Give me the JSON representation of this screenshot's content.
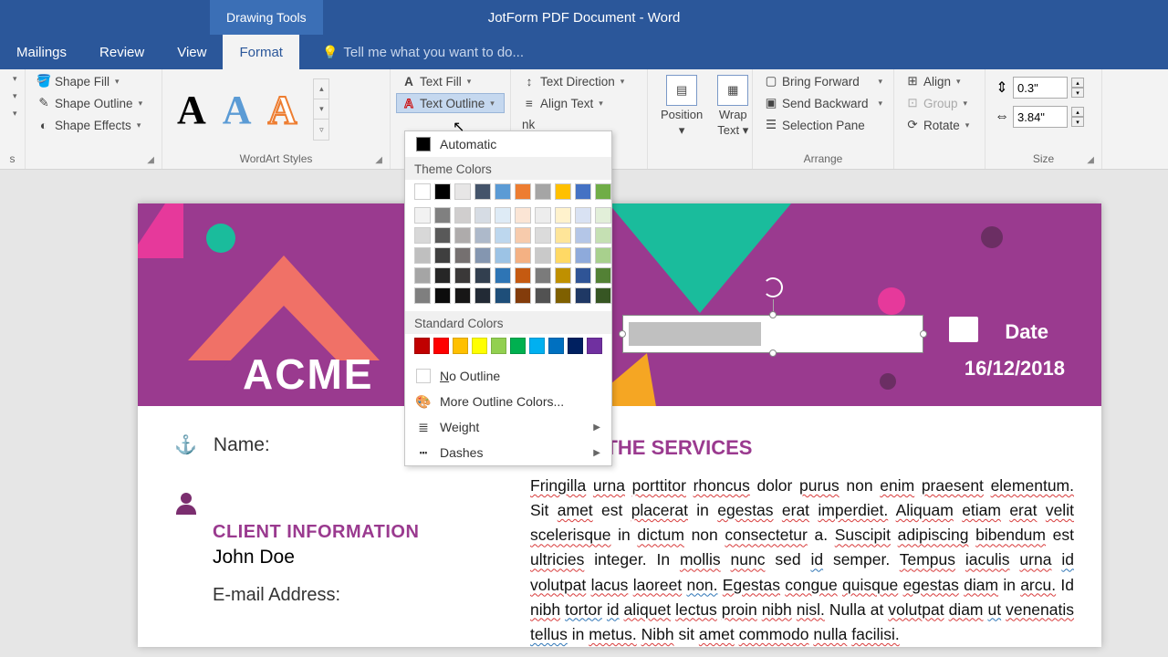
{
  "titlebar": {
    "context": "Drawing Tools",
    "title": "JotForm PDF Document - Word"
  },
  "tabs": {
    "mailings": "Mailings",
    "review": "Review",
    "view": "View",
    "format": "Format",
    "tellme": "Tell me what you want to do..."
  },
  "ribbon": {
    "shape_fill": "Shape Fill",
    "shape_outline": "Shape Outline",
    "shape_effects": "Shape Effects",
    "shape_styles_lbl": "s",
    "wordart_lbl": "WordArt Styles",
    "text_fill": "Text Fill",
    "text_outline": "Text Outline",
    "text_direction": "Text Direction",
    "align_text": "Align Text",
    "create_link_tail": "nk",
    "position": "Position",
    "wrap_text_1": "Wrap",
    "wrap_text_2": "Text",
    "bring_forward": "Bring Forward",
    "send_backward": "Send Backward",
    "selection_pane": "Selection Pane",
    "align": "Align",
    "group": "Group",
    "rotate": "Rotate",
    "arrange_lbl": "Arrange",
    "size_lbl": "Size",
    "height_val": "0.3\"",
    "width_val": "3.84\""
  },
  "dropdown": {
    "automatic": "Automatic",
    "theme_hdr": "Theme Colors",
    "standard_hdr": "Standard Colors",
    "no_outline": "No Outline",
    "more_colors": "More Outline Colors...",
    "weight": "Weight",
    "dashes": "Dashes",
    "theme_row1": [
      "#ffffff",
      "#000000",
      "#e7e6e6",
      "#44546a",
      "#5b9bd5",
      "#ed7d31",
      "#a5a5a5",
      "#ffc000",
      "#4472c4",
      "#70ad47"
    ],
    "theme_shades": [
      [
        "#f2f2f2",
        "#808080",
        "#d0cece",
        "#d6dce4",
        "#deebf6",
        "#fbe5d5",
        "#ededed",
        "#fff2cc",
        "#d9e2f3",
        "#e2efd9"
      ],
      [
        "#d8d8d8",
        "#595959",
        "#aeabab",
        "#adb9ca",
        "#bdd7ee",
        "#f7cbac",
        "#dbdbdb",
        "#fee599",
        "#b4c6e7",
        "#c5e0b3"
      ],
      [
        "#bfbfbf",
        "#3f3f3f",
        "#757070",
        "#8496b0",
        "#9cc3e5",
        "#f4b183",
        "#c9c9c9",
        "#ffd965",
        "#8eaadb",
        "#a8d08d"
      ],
      [
        "#a5a5a5",
        "#262626",
        "#3a3838",
        "#323f4f",
        "#2e75b5",
        "#c55a11",
        "#7b7b7b",
        "#bf9000",
        "#2f5496",
        "#538135"
      ],
      [
        "#7f7f7f",
        "#0c0c0c",
        "#171616",
        "#222a35",
        "#1e4e79",
        "#833c0b",
        "#525252",
        "#7f6000",
        "#1f3864",
        "#375623"
      ]
    ],
    "standard": [
      "#c00000",
      "#ff0000",
      "#ffc000",
      "#ffff00",
      "#92d050",
      "#00b050",
      "#00b0f0",
      "#0070c0",
      "#002060",
      "#7030a0"
    ]
  },
  "doc": {
    "acme": "ACME",
    "date_lbl": "Date",
    "date_val": "16/12/2018",
    "name_lbl": "Name:",
    "client_hdr": "CLIENT INFORMATION",
    "client_name": "John Doe",
    "email_lbl": "E-mail Address:",
    "svc_title": "1. THE SERVICES",
    "svc_body_parts": [
      "Fringilla urna porttitor rhoncus dolor purus non enim praesent elementum. Sit amet est placerat in egestas erat imperdiet. Aliquam etiam erat velit scelerisque in dictum non consectetur a. Suscipit adipiscing bibendum est ultricies integer. In mollis nunc sed id semper. Tempus iaculis urna id volutpat lacus laoreet non. Egestas congue quisque egestas diam in arcu. Id nibh tortor id aliquet lectus proin nibh nisl. Nulla at volutpat diam ut venenatis tellus in metus. Nibh sit amet commodo nulla facilisi."
    ]
  }
}
